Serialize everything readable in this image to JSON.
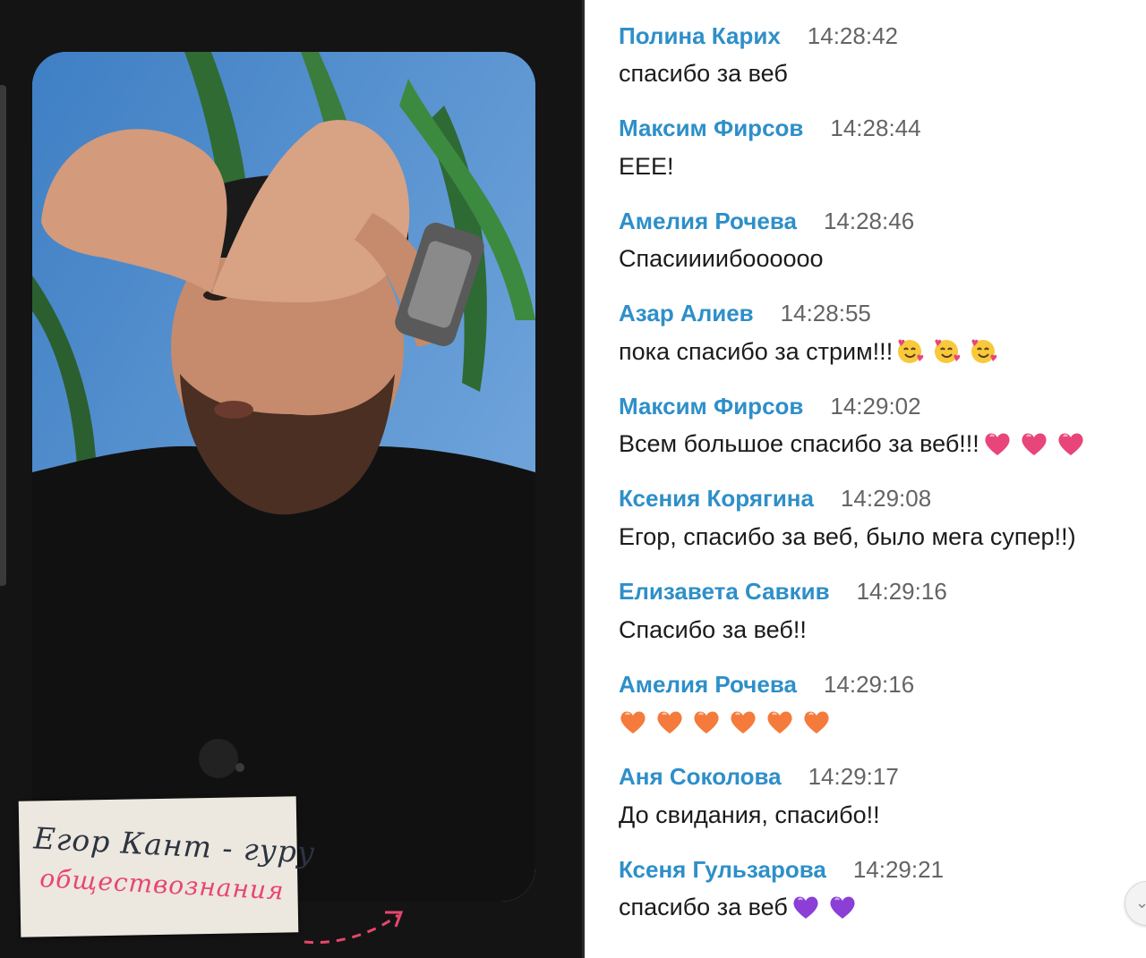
{
  "video": {
    "caption_line1": "Егор Кант - гуру",
    "caption_line2": "обществознания"
  },
  "messages": [
    {
      "author": "Полина Карих",
      "time": "14:28:42",
      "text": "спасибо за веб",
      "emojis": []
    },
    {
      "author": "Максим Фирсов",
      "time": "14:28:44",
      "text": "ЕЕЕ!",
      "emojis": []
    },
    {
      "author": "Амелия Рочева",
      "time": "14:28:46",
      "text": "Спасиииибоооооо",
      "emojis": []
    },
    {
      "author": "Азар Алиев",
      "time": "14:28:55",
      "text": "пока спасибо за стрим!!!",
      "emojis": [
        "smiling-face-with-hearts",
        "smiling-face-with-hearts",
        "smiling-face-with-hearts"
      ]
    },
    {
      "author": "Максим Фирсов",
      "time": "14:29:02",
      "text": "Всем большое спасибо за веб!!!",
      "emojis": [
        "pink-heart",
        "pink-heart",
        "pink-heart"
      ]
    },
    {
      "author": "Ксения Корягина",
      "time": "14:29:08",
      "text": "Егор, спасибо за веб, было мега супер!!)",
      "emojis": []
    },
    {
      "author": "Елизавета Савкив",
      "time": "14:29:16",
      "text": "Спасибо за веб!!",
      "emojis": []
    },
    {
      "author": "Амелия Рочева",
      "time": "14:29:16",
      "text": "",
      "emojis": [
        "orange-heart",
        "orange-heart",
        "orange-heart",
        "orange-heart",
        "orange-heart",
        "orange-heart"
      ]
    },
    {
      "author": "Аня Соколова",
      "time": "14:29:17",
      "text": "До свидания, спасибо!!",
      "emojis": []
    },
    {
      "author": "Ксеня Гульзарова",
      "time": "14:29:21",
      "text": "спасибо за веб",
      "emojis": [
        "purple-heart",
        "purple-heart"
      ]
    }
  ],
  "colors": {
    "author": "#2e8fc9",
    "time": "#646464",
    "caption_accent": "#e8466e",
    "pink-heart": "#e8457a",
    "orange-heart": "#f47b3b",
    "purple-heart": "#8b3fd6",
    "smiley": "#f7c93b"
  }
}
